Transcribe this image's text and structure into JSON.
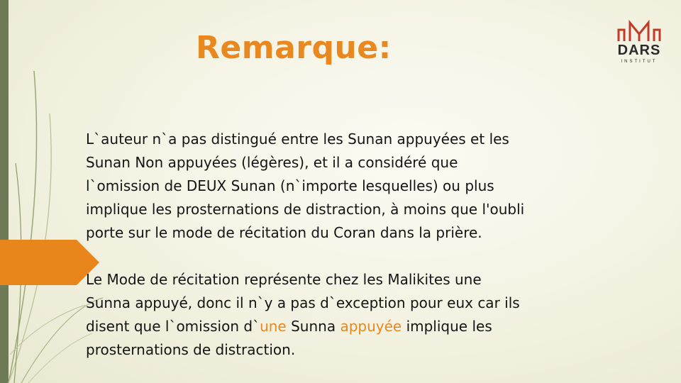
{
  "slide": {
    "title": "Remarque:",
    "logo": {
      "name": "DARS",
      "subtitle": "INSTITUT"
    },
    "paragraph1_lines": [
      "L`auteur n`a pas distingué entre les Sunan appuyées et les",
      "Sunan Non appuyées (légères), et il a considéré que",
      "l`omission de DEUX Sunan (n`importe lesquelles) ou plus",
      "implique les prosternations de distraction, à moins que l'oubli",
      "porte sur le mode de récitation du Coran dans la prière."
    ],
    "paragraph2_lines": [
      "Le Mode de récitation représente chez les Malikites une",
      "Sunna appuyé, donc il n`y a pas d`exception pour eux car ils"
    ],
    "paragraph2_line3": {
      "before": "disent que l`omission d`",
      "highlight1": "une",
      "middle": " Sunna ",
      "highlight2": "appuyée",
      "after": " implique les"
    },
    "paragraph2_line4": "prosternations de distraction."
  },
  "colors": {
    "accent": "#e8881e",
    "text": "#141414",
    "bar": "#6d7a55"
  }
}
